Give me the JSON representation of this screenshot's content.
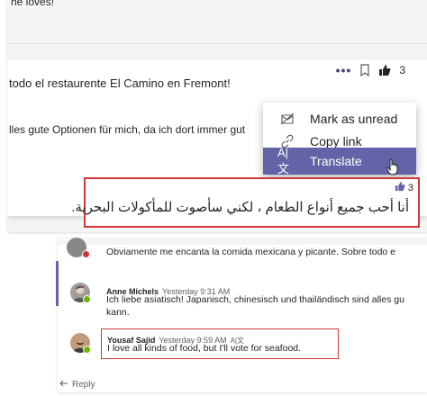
{
  "top": {
    "cut_text": "he loves!",
    "spanish_line": "todo el restaurente El Camino en Fremont!",
    "german_line": "lles gute Optionen für mich, da ich dort immer gut",
    "like_count": "3",
    "menu": {
      "items": [
        {
          "label": "Mark as unread",
          "icon": "mark-unread-icon"
        },
        {
          "label": "Copy link",
          "icon": "link-icon"
        },
        {
          "label": "Translate",
          "icon": "translate-icon",
          "highlighted": true
        }
      ]
    },
    "arabic": {
      "like_count": "3",
      "text": "أنا أحب جميع أنواع الطعام ، لكني سأصوت للمأكولات البحرية."
    }
  },
  "bottom": {
    "cut_message": "Obviamente me encanta la comida mexicana y picante. Sobre todo e",
    "messages": [
      {
        "author": "Anne Michels",
        "time": "Yesterday 9:31 AM",
        "text": "Ich liebe asiatisch! Japanisch, chinesisch und thailändisch sind alles gu kann."
      },
      {
        "author": "Yousaf Sajid",
        "time": "Yesterday 9:59 AM",
        "text": "I love all kinds of food, but I'll vote for seafood."
      }
    ],
    "reply_label": "Reply"
  },
  "colors": {
    "accent": "#6264a7",
    "highlight_border": "#d1383a",
    "presence_available": "#6bb700",
    "presence_busy": "#d13438"
  }
}
